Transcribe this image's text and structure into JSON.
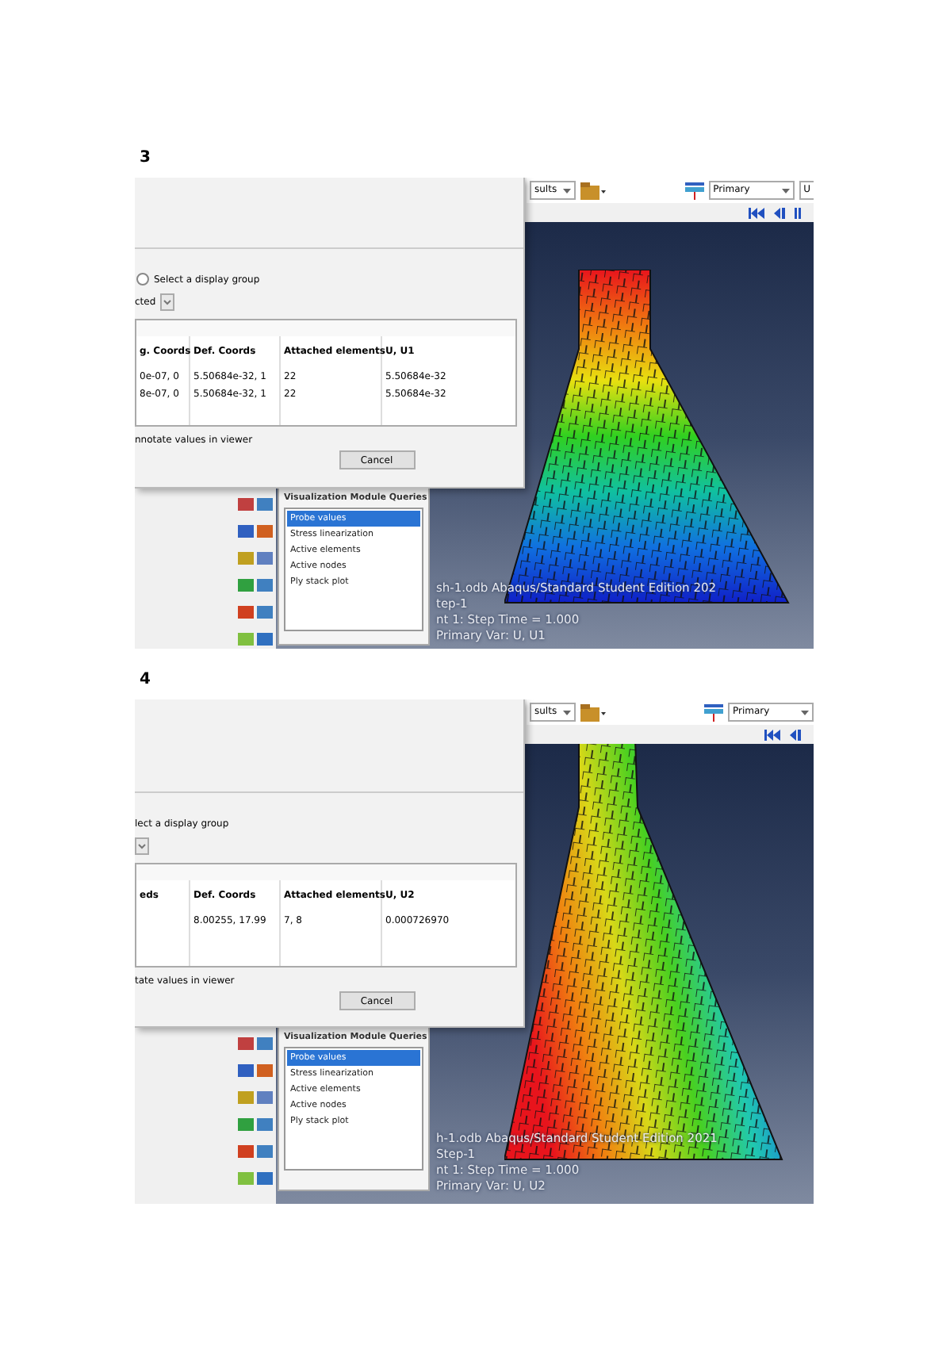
{
  "figures": [
    {
      "label": "3",
      "toolbar": {
        "results_combo": "sults",
        "primary_combo": "Primary",
        "cut_combo": "U"
      },
      "dialog": {
        "radio": {
          "label": "Select a display group",
          "selected": false
        },
        "combo_value": "cted",
        "columns": [
          {
            "header": "g. Coords",
            "cells": [
              "0e-07, 0",
              "8e-07, 0"
            ]
          },
          {
            "header": "Def. Coords",
            "cells": [
              "5.50684e-32, 1",
              "5.50684e-32, 1"
            ]
          },
          {
            "header": "Attached elements",
            "cells": [
              "22",
              "22"
            ]
          },
          {
            "header": "U, U1",
            "cells": [
              "5.50684e-32",
              "5.50684e-32"
            ]
          }
        ],
        "footer": "nnotate values in viewer",
        "cancel": "Cancel"
      },
      "queries": {
        "title": "Visualization Module Queries",
        "items": [
          {
            "label": "Probe values",
            "selected": true
          },
          {
            "label": "Stress linearization",
            "selected": false
          },
          {
            "label": "Active elements",
            "selected": false
          },
          {
            "label": "Active nodes",
            "selected": false
          },
          {
            "label": "Ply stack plot",
            "selected": false
          }
        ]
      },
      "viewport": {
        "kind": "vertical",
        "legend": [
          "sh-1.odb    Abaqus/Standard Student Edition 202",
          "tep-1",
          "nt     1: Step Time =     1.000",
          "Primary Var: U, U1"
        ]
      }
    },
    {
      "label": "4",
      "toolbar": {
        "results_combo": "sults",
        "primary_combo": "Primary"
      },
      "dialog": {
        "radio": {
          "label": "lect a display group"
        },
        "columns": [
          {
            "header": "eds"
          },
          {
            "header": "Def. Coords",
            "cells": [
              "8.00255, 17.99"
            ]
          },
          {
            "header": "Attached elements",
            "cells": [
              "7, 8"
            ]
          },
          {
            "header": "U, U2",
            "cells": [
              "0.000726970"
            ]
          }
        ],
        "footer": "tate values in viewer",
        "cancel": "Cancel"
      },
      "queries": {
        "title": "Visualization Module Queries",
        "items": [
          {
            "label": "Probe values",
            "selected": true
          },
          {
            "label": "Stress linearization",
            "selected": false
          },
          {
            "label": "Active elements",
            "selected": false
          },
          {
            "label": "Active nodes",
            "selected": false
          },
          {
            "label": "Ply stack plot",
            "selected": false
          }
        ]
      },
      "viewport": {
        "kind": "diagonal",
        "legend": [
          "h-1.odb    Abaqus/Standard Student Edition 2021",
          "Step-1",
          "nt     1: Step Time =     1.000",
          "Primary Var: U, U2"
        ]
      }
    }
  ]
}
